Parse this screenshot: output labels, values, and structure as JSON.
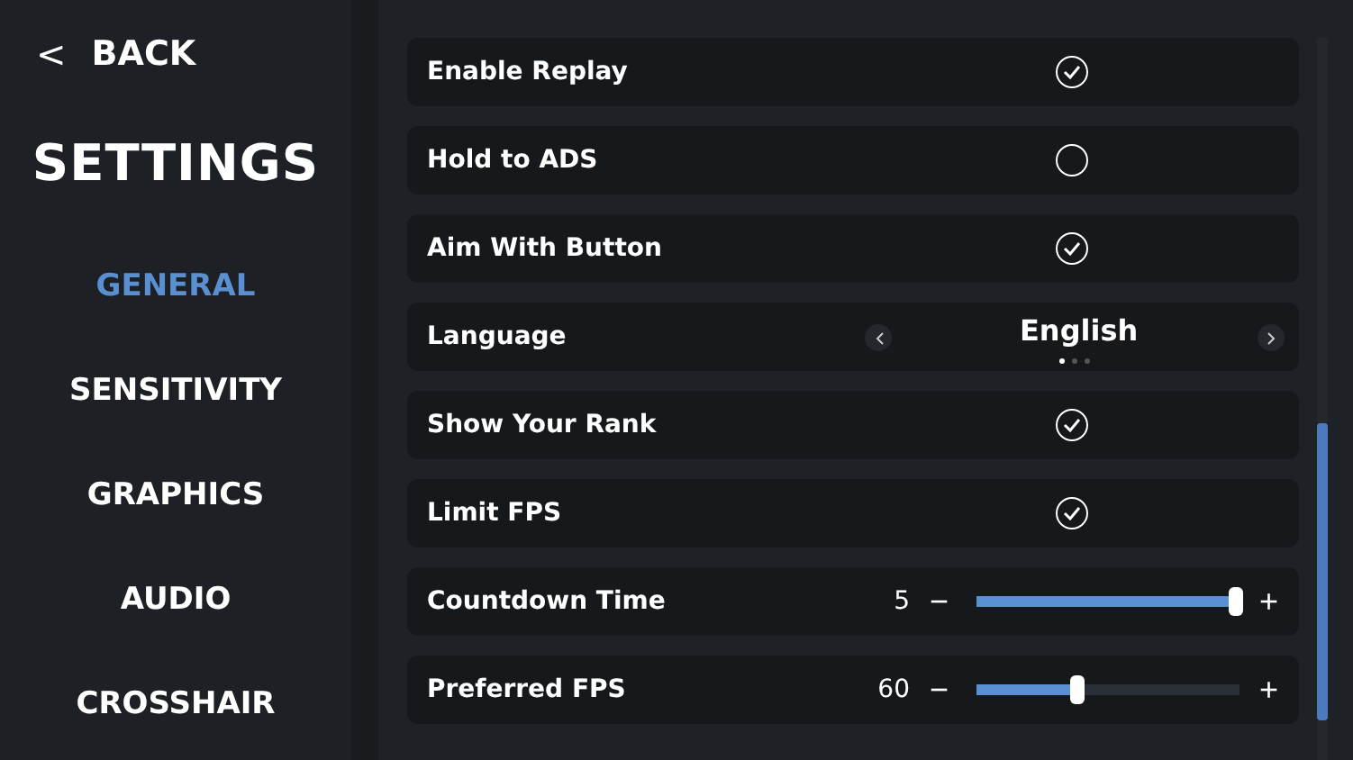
{
  "back": {
    "icon": "<",
    "label": "BACK"
  },
  "title": "SETTINGS",
  "sidebar": {
    "items": [
      {
        "label": "GENERAL",
        "selected": true
      },
      {
        "label": "SENSITIVITY",
        "selected": false
      },
      {
        "label": "GRAPHICS",
        "selected": false
      },
      {
        "label": "AUDIO",
        "selected": false
      },
      {
        "label": "CROSSHAIR",
        "selected": false
      }
    ]
  },
  "settings": [
    {
      "kind": "toggle",
      "label": "Enable Replay",
      "checked": true
    },
    {
      "kind": "toggle",
      "label": "Hold to ADS",
      "checked": false
    },
    {
      "kind": "toggle",
      "label": "Aim With Button",
      "checked": true
    },
    {
      "kind": "select",
      "label": "Language",
      "value": "English",
      "pages": [
        {
          "selected": true
        },
        {
          "selected": false
        },
        {
          "selected": false
        }
      ]
    },
    {
      "kind": "toggle",
      "label": "Show Your Rank",
      "checked": true
    },
    {
      "kind": "toggle",
      "label": "Limit FPS",
      "checked": true
    },
    {
      "kind": "slider",
      "label": "Countdown Time",
      "reading": "5",
      "minus": "−",
      "plus": "+",
      "level": 1
    },
    {
      "kind": "slider",
      "label": "Preferred FPS",
      "reading": "60",
      "minus": "−",
      "plus": "+",
      "level": 0.4
    }
  ]
}
